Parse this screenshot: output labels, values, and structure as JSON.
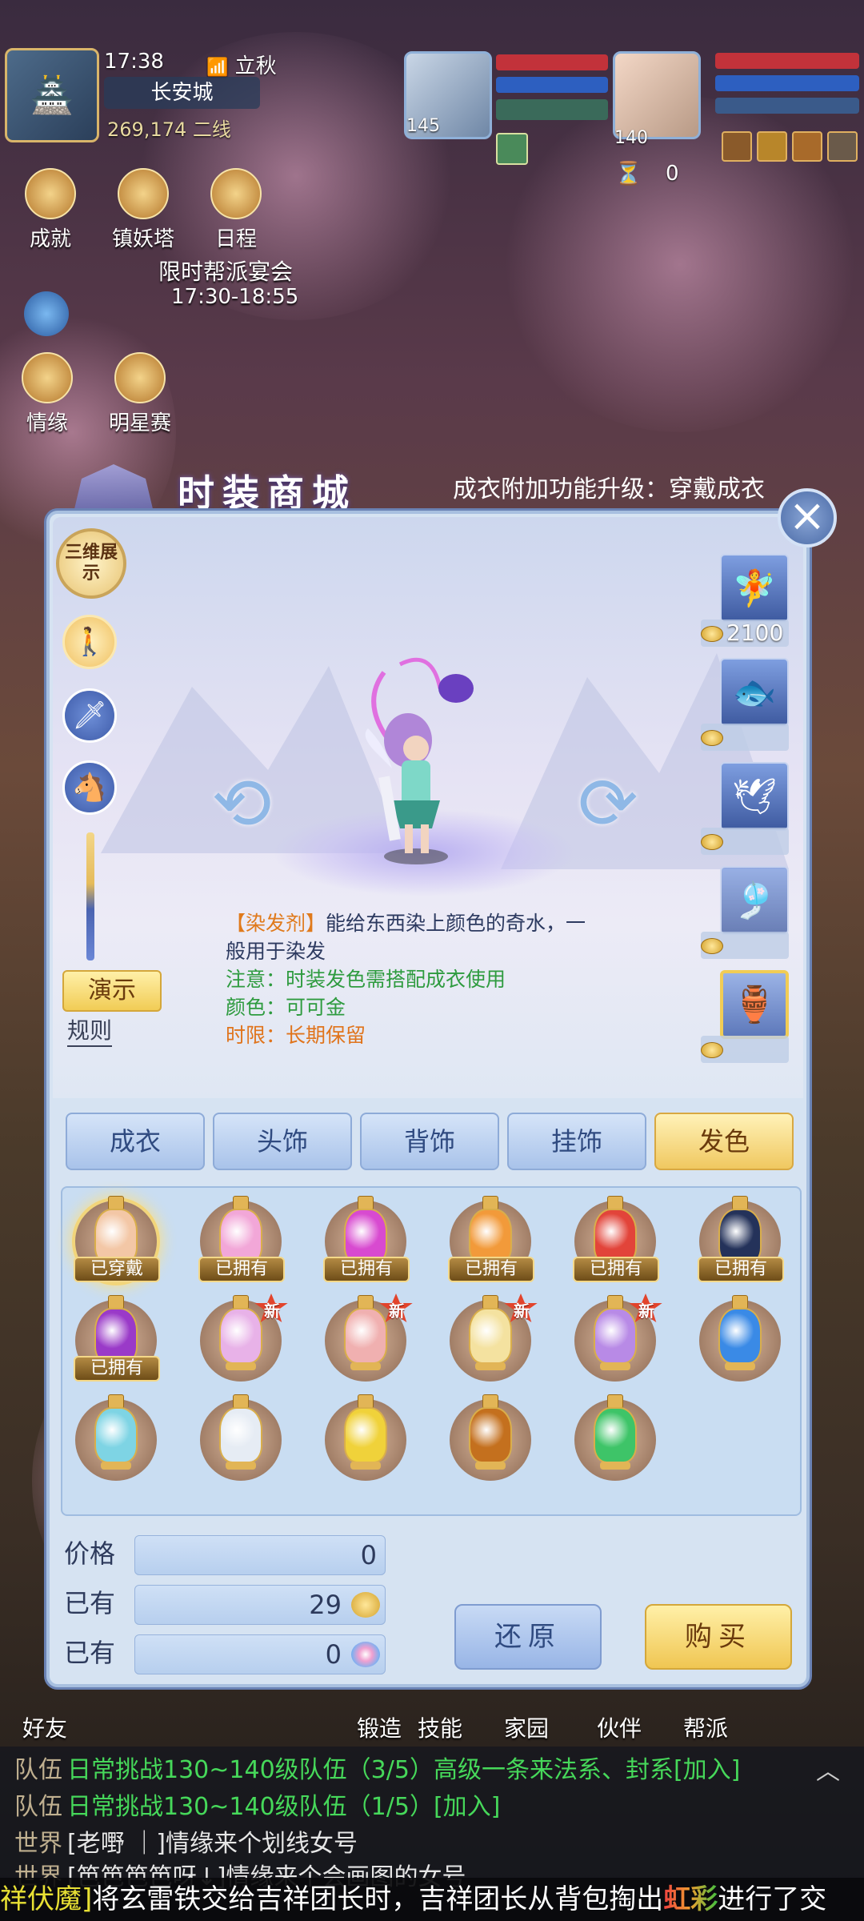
{
  "hud": {
    "time": "17:38",
    "solar_term": "立秋",
    "city": "长安城",
    "coords_line": "269,174  二线",
    "pet_level": "145",
    "player_level": "140",
    "buff_count": "0",
    "left_icons": [
      {
        "label": "成就"
      },
      {
        "label": "镇妖塔"
      },
      {
        "label": "日程"
      },
      {
        "label": "情缘"
      },
      {
        "label": "明星赛"
      }
    ],
    "event_title": "限时帮派宴会",
    "event_time": "17:30-18:55"
  },
  "shop": {
    "title": "时装商城",
    "marquee": "成衣附加功能升级：穿戴成衣",
    "view_3d_label": "三维展示",
    "demo_label": "演示",
    "rules_label": "规则",
    "description": {
      "tag": "【染发剂】",
      "text_line1": "能给东西染上颜色的奇水，一",
      "text_line2": "般用于染发",
      "note": "注意：时装发色需搭配成衣使用",
      "color": "颜色：可可金",
      "duration": "时限：长期保留"
    },
    "side_items": [
      {
        "price": "2100"
      },
      {
        "price": ""
      },
      {
        "price": ""
      },
      {
        "price": ""
      },
      {
        "price": ""
      }
    ],
    "tabs": [
      {
        "label": "成衣"
      },
      {
        "label": "头饰"
      },
      {
        "label": "背饰"
      },
      {
        "label": "挂饰"
      },
      {
        "label": "发色"
      }
    ],
    "active_tab": "发色",
    "items": [
      {
        "color": "#f3c7a6",
        "badge": "已穿戴",
        "new": false,
        "selected": true
      },
      {
        "color": "#f2a7d8",
        "badge": "已拥有",
        "new": false
      },
      {
        "color": "#d84ad0",
        "badge": "已拥有",
        "new": false
      },
      {
        "color": "#f29a3a",
        "badge": "已拥有",
        "new": false
      },
      {
        "color": "#e2443a",
        "badge": "已拥有",
        "new": false
      },
      {
        "color": "#24325a",
        "badge": "已拥有",
        "new": false
      },
      {
        "color": "#9a3ac8",
        "badge": "已拥有",
        "new": false
      },
      {
        "color": "#e8b2e8",
        "badge": "",
        "new": true
      },
      {
        "color": "#f0b0b0",
        "badge": "",
        "new": true
      },
      {
        "color": "#f4e2a0",
        "badge": "",
        "new": true
      },
      {
        "color": "#b88ae6",
        "badge": "",
        "new": true
      },
      {
        "color": "#3a8ae6",
        "badge": "",
        "new": false
      },
      {
        "color": "#7ed4e4",
        "badge": "",
        "new": false
      },
      {
        "color": "#e6ecf4",
        "badge": "",
        "new": false
      },
      {
        "color": "#f0d23a",
        "badge": "",
        "new": false
      },
      {
        "color": "#c4701e",
        "badge": "",
        "new": false
      },
      {
        "color": "#3ec468",
        "badge": "",
        "new": false
      }
    ],
    "new_label": "新",
    "price_label": "价格",
    "price_value": "0",
    "owned_label_1": "已有",
    "owned_value_1": "29",
    "owned_label_2": "已有",
    "owned_value_2": "0",
    "restore_label": "还原",
    "buy_label": "购买"
  },
  "bottom_nav": [
    {
      "label": "好友"
    },
    {
      "label": "锻造"
    },
    {
      "label": "技能"
    },
    {
      "label": "家园"
    },
    {
      "label": "伙伴"
    },
    {
      "label": "帮派"
    }
  ],
  "chat": [
    {
      "channel": "队伍",
      "text": "日常挑战130~140级队伍（3/5）高级一条来法系、封系[加入]"
    },
    {
      "channel": "队伍",
      "text": "日常挑战130~140级队伍（1/5）[加入]"
    },
    {
      "channel": "世界",
      "text": "[老嘢 ｜]情缘来个划线女号"
    },
    {
      "channel": "世界",
      "text": "[笆笆笆笆呀↓]情缘来个会画图的女号"
    }
  ],
  "broadcast": {
    "part1": "祥伏魔]",
    "part2": "将玄雷铁交给吉祥团长时，吉祥团长从背包掏出",
    "part3": "虹彩",
    "part4": "进行了交"
  }
}
